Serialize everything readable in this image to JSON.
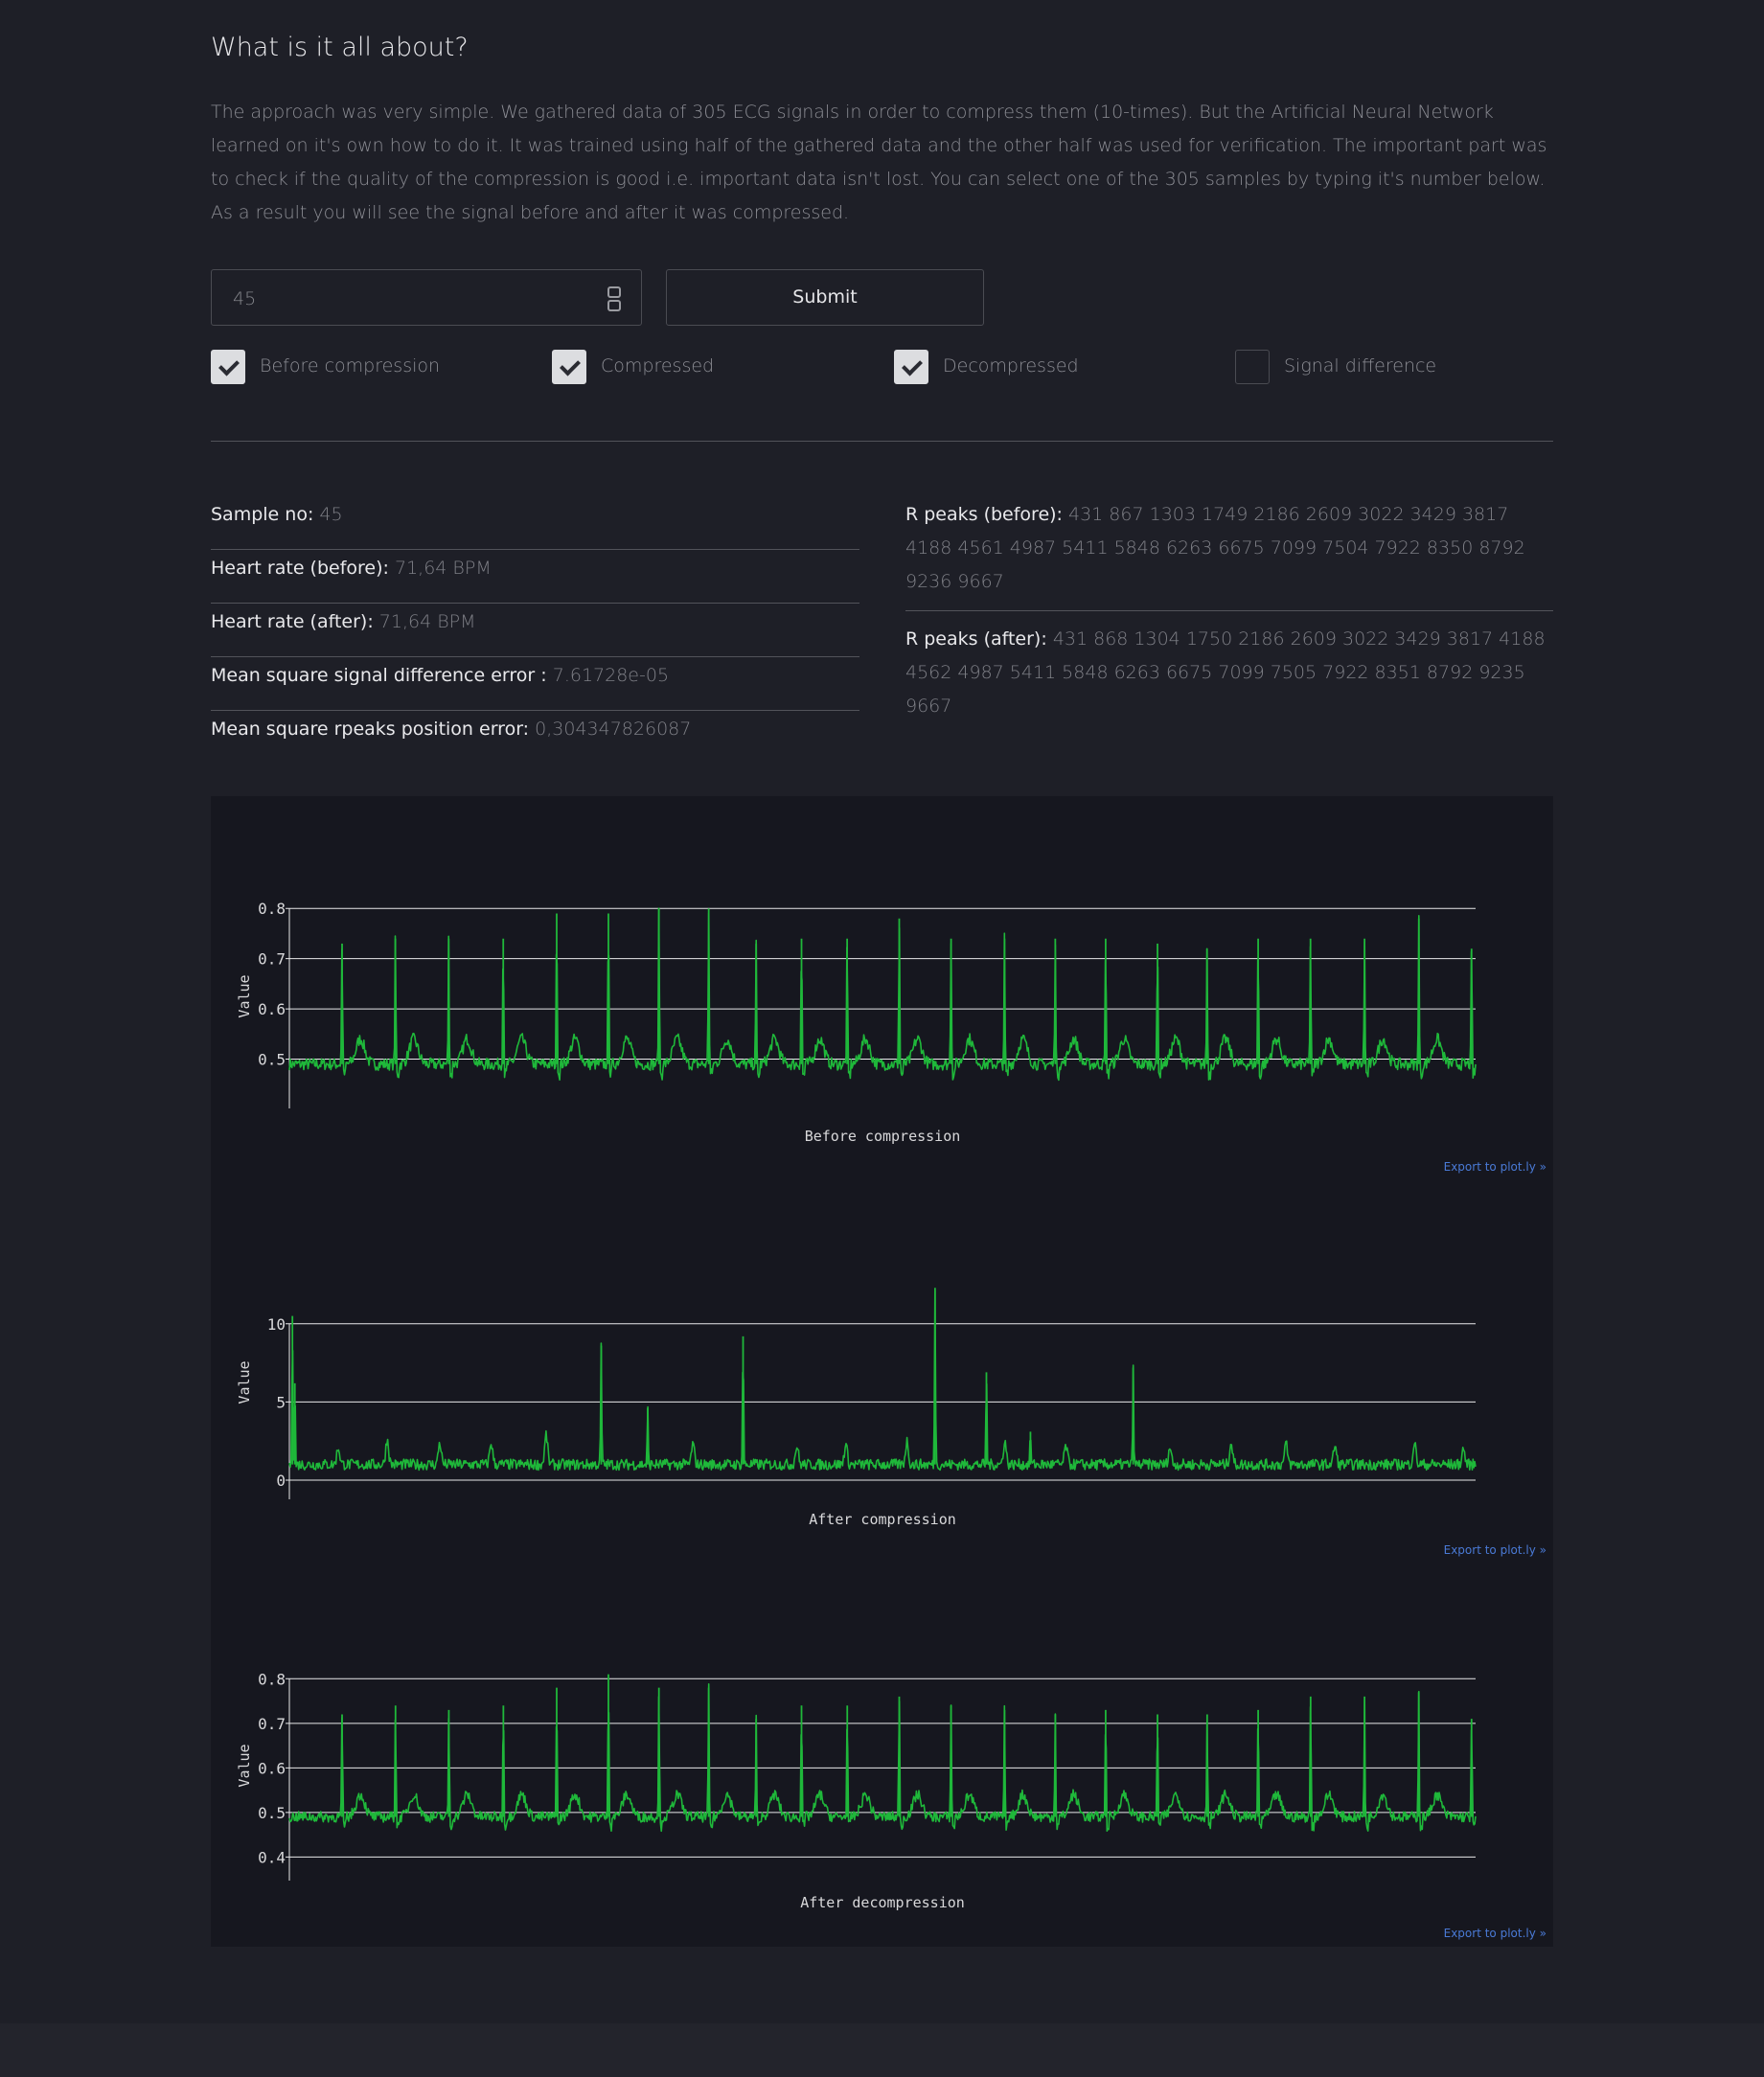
{
  "intro": {
    "title": "What is it all about?",
    "text": "The approach was very simple. We gathered data of 305 ECG signals in order to compress them (10-times). But the Artificial Neural Network learned on it's own how to do it. It was trained using half of the gathered data and the other half was used for verification. The important part was to check if the quality of the compression is good i.e. important data isn't lost. You can select one of the 305 samples by typing it's number below. As a result you will see the signal before and after it was compressed."
  },
  "form": {
    "sample_value": "45",
    "submit_label": "Submit"
  },
  "checkboxes": [
    {
      "label": "Before compression",
      "checked": true
    },
    {
      "label": "Compressed",
      "checked": true
    },
    {
      "label": "Decompressed",
      "checked": true
    },
    {
      "label": "Signal difference",
      "checked": false
    }
  ],
  "stats": {
    "sample_no": {
      "label": "Sample no:",
      "value": "45"
    },
    "hr_before": {
      "label": "Heart rate (before):",
      "value": "71,64 BPM"
    },
    "hr_after": {
      "label": "Heart rate (after):",
      "value": "71,64 BPM"
    },
    "mse_signal": {
      "label": "Mean square signal difference error :",
      "value": "7.61728e-05"
    },
    "mse_rpeaks": {
      "label": "Mean square rpeaks position error:",
      "value": "0,304347826087"
    },
    "rpeaks_before": {
      "label": "R peaks (before):",
      "value": "431 867 1303 1749 2186 2609 3022 3429 3817 4188 4561 4987 5411 5848 6263 6675 7099 7504 7922 8350 8792 9236 9667"
    },
    "rpeaks_after": {
      "label": "R peaks (after):",
      "value": "431 868 1304 1750 2186 2609 3022 3429 3817 4188 4562 4987 5411 5848 6263 6675 7099 7505 7922 8351 8792 9235 9667"
    }
  },
  "export_label": "Export to plot.ly »",
  "colors": {
    "trace": "#1fb83a",
    "background": "#1e1f27",
    "plot_bg": "#16171f",
    "link": "#4a7ad6"
  },
  "chart_data": [
    {
      "type": "line",
      "title": "Before compression",
      "ylabel": "Value",
      "yticks": [
        0.5,
        0.6,
        0.7,
        0.8
      ],
      "ylim": [
        0.44,
        0.81
      ],
      "baseline": 0.49,
      "noise": 0.012,
      "twave": 0.05,
      "peaks_x": [
        431,
        867,
        1303,
        1749,
        2186,
        2609,
        3022,
        3429,
        3817,
        4188,
        4561,
        4987,
        5411,
        5848,
        6263,
        6675,
        7099,
        7504,
        7922,
        8350,
        8792,
        9236,
        9667
      ],
      "peaks_y": [
        0.73,
        0.74,
        0.74,
        0.74,
        0.79,
        0.79,
        0.8,
        0.8,
        0.73,
        0.74,
        0.74,
        0.78,
        0.74,
        0.74,
        0.74,
        0.74,
        0.73,
        0.72,
        0.74,
        0.74,
        0.74,
        0.78,
        0.72
      ],
      "xlim": [
        0,
        9700
      ]
    },
    {
      "type": "line",
      "title": "After compression",
      "ylabel": "Value",
      "yticks": [
        0,
        5,
        10
      ],
      "ylim": [
        0,
        12.5
      ],
      "baseline": 1.0,
      "noise": 0.35,
      "twave": 0.0,
      "peaks_x": [
        25,
        45,
        2550,
        2930,
        3710,
        5280,
        5700,
        6060,
        6900
      ],
      "peaks_y": [
        10.5,
        6.2,
        8.6,
        4.6,
        9.2,
        12.3,
        6.9,
        3.1,
        7.2
      ],
      "small_peaks_x": [
        400,
        800,
        1230,
        1650,
        2100,
        3300,
        4150,
        4550,
        5050,
        5850,
        6350,
        7200,
        7700,
        8150,
        8550,
        9200,
        9600
      ],
      "small_peaks_y": [
        2.1,
        2.6,
        2.4,
        2.4,
        2.9,
        2.3,
        2.2,
        2.3,
        2.5,
        2.5,
        2.2,
        2.1,
        2.4,
        2.3,
        2.2,
        2.4,
        2.0
      ],
      "xlim": [
        0,
        9700
      ]
    },
    {
      "type": "line",
      "title": "After decompression",
      "ylabel": "Value",
      "yticks": [
        0.4,
        0.5,
        0.6,
        0.7,
        0.8
      ],
      "ylim": [
        0.39,
        0.82
      ],
      "baseline": 0.49,
      "noise": 0.012,
      "twave": 0.05,
      "peaks_x": [
        431,
        868,
        1304,
        1750,
        2186,
        2609,
        3022,
        3429,
        3817,
        4188,
        4562,
        4987,
        5411,
        5848,
        6263,
        6675,
        7099,
        7505,
        7922,
        8351,
        8792,
        9235,
        9667
      ],
      "peaks_y": [
        0.72,
        0.74,
        0.73,
        0.74,
        0.78,
        0.81,
        0.78,
        0.78,
        0.71,
        0.74,
        0.74,
        0.76,
        0.74,
        0.73,
        0.72,
        0.73,
        0.72,
        0.72,
        0.73,
        0.76,
        0.76,
        0.77,
        0.71
      ],
      "xlim": [
        0,
        9700
      ]
    }
  ]
}
